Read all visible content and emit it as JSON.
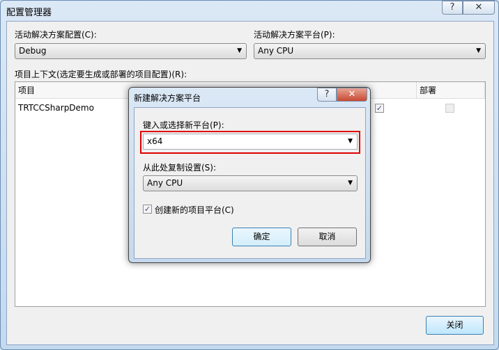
{
  "window": {
    "title": "配置管理器",
    "help": "?",
    "close": "✕"
  },
  "config": {
    "label": "活动解决方案配置(C):",
    "value": "Debug"
  },
  "platform": {
    "label": "活动解决方案平台(P):",
    "value": "Any CPU"
  },
  "context": {
    "label": "项目上下文(选定要生成或部署的项目配置)(R):",
    "columns": [
      "项目",
      "部署"
    ],
    "rows": [
      {
        "project": "TRTCCSharpDemo",
        "build_checked": true,
        "deploy_checked": false
      }
    ]
  },
  "close_button": "关闭",
  "dialog": {
    "title": "新建解决方案平台",
    "help": "?",
    "close": "✕",
    "new_platform_label": "键入或选择新平台(P):",
    "new_platform_value": "x64",
    "copy_label": "从此处复制设置(S):",
    "copy_value": "Any CPU",
    "create_label": "创建新的项目平台(C)",
    "create_checked": true,
    "ok": "确定",
    "cancel": "取消",
    "highlight_color": "#e00000"
  }
}
